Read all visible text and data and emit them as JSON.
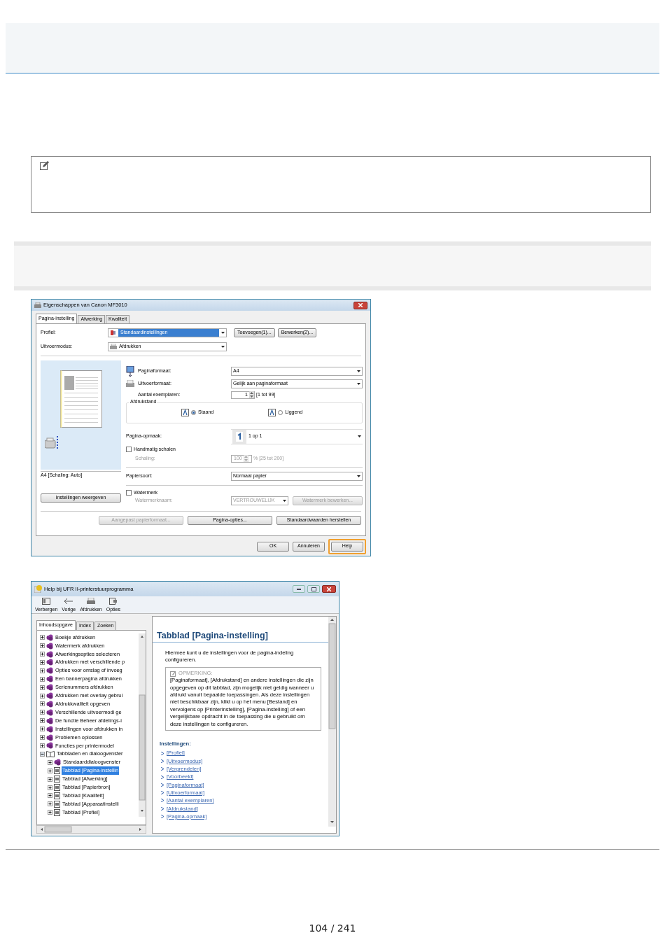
{
  "dialog1": {
    "title": "Eigenschappen van Canon MF3010",
    "tabs": [
      {
        "label": "Pagina-instelling",
        "selected": true
      },
      {
        "label": "Afwerking",
        "selected": false
      },
      {
        "label": "Kwaliteit",
        "selected": false
      }
    ],
    "profile": {
      "label": "Profiel:",
      "value": "Standaardinstellingen"
    },
    "profile_buttons": [
      "Toevoegen(1)...",
      "Bewerken(2)..."
    ],
    "output_mode": {
      "label": "Uitvoermodus:",
      "value": "Afdrukken"
    },
    "preview_caption": "A4 [Schaling: Auto]",
    "show_settings_button": "Instellingen weergeven",
    "page_size": {
      "label": "Paginaformaat:",
      "value": "A4"
    },
    "output_size": {
      "label": "Uitvoerformaat:",
      "value": "Gelijk aan paginaformaat"
    },
    "copies": {
      "label": "Aantal exemplaren:",
      "value": "1",
      "range": "[1 tot 99]"
    },
    "orientation": {
      "legend": "Afdrukstand",
      "options": [
        {
          "label": "Staand",
          "selected": true
        },
        {
          "label": "Liggend",
          "selected": false
        }
      ]
    },
    "layout": {
      "label": "Pagina-opmaak:",
      "value": "1 op 1"
    },
    "manual_scaling": {
      "label": "Handmatig schalen",
      "checked": false
    },
    "scaling": {
      "label": "Schaling:",
      "value": "100",
      "range": "% [25 tot 200]",
      "disabled": true
    },
    "paper_type": {
      "label": "Papiersoort:",
      "value": "Normaal papier"
    },
    "watermark": {
      "label": "Watermerk",
      "checked": false
    },
    "watermark_name": {
      "label": "Watermerknaam:",
      "value": "VERTROUWELIJK",
      "button": "Watermerk bewerken...",
      "disabled": true
    },
    "bottom_buttons": [
      {
        "label": "Aangepast papierformaat...",
        "disabled": true
      },
      {
        "label": "Pagina-opties...",
        "disabled": false
      },
      {
        "label": "Standaardwaarden herstellen",
        "disabled": false
      }
    ],
    "footer_buttons": [
      {
        "label": "OK",
        "highlighted": false
      },
      {
        "label": "Annuleren",
        "highlighted": false
      },
      {
        "label": "Help",
        "highlighted": true
      }
    ]
  },
  "dialog2": {
    "title": "Help bij UFR II-printerstuurprogramma",
    "toolbar": [
      "Verbergen",
      "Vorige",
      "Afdrukken",
      "Opties"
    ],
    "tabs": [
      {
        "label": "Inhoudsopgave",
        "selected": true
      },
      {
        "label": "Index",
        "selected": false
      },
      {
        "label": "Zoeken",
        "selected": false
      }
    ],
    "tree": [
      {
        "label": "Boekje afdrukken",
        "kind": "book",
        "expanded": false,
        "selected": false
      },
      {
        "label": "Watermerk afdrukken",
        "kind": "book",
        "expanded": false,
        "selected": false
      },
      {
        "label": "Afwerkingsopties selecteren",
        "kind": "book",
        "expanded": false,
        "selected": false
      },
      {
        "label": "Afdrukken met verschillende p",
        "kind": "book",
        "expanded": false,
        "selected": false
      },
      {
        "label": "Opties voor omslag of invoeg",
        "kind": "book",
        "expanded": false,
        "selected": false
      },
      {
        "label": "Een bannerpagina afdrukken",
        "kind": "book",
        "expanded": false,
        "selected": false
      },
      {
        "label": "Serienummers afdrukken",
        "kind": "book",
        "expanded": false,
        "selected": false
      },
      {
        "label": "Afdrukken met overlay gebrui",
        "kind": "book",
        "expanded": false,
        "selected": false
      },
      {
        "label": "Afdrukkwaliteit opgeven",
        "kind": "book",
        "expanded": false,
        "selected": false
      },
      {
        "label": "Verschillende uitvoermodi ge",
        "kind": "book",
        "expanded": false,
        "selected": false
      },
      {
        "label": "De functie Beheer afdelings-i",
        "kind": "book",
        "expanded": false,
        "selected": false
      },
      {
        "label": "Instellingen voor afdrukken in",
        "kind": "book",
        "expanded": false,
        "selected": false
      },
      {
        "label": "Problemen oplossen",
        "kind": "book",
        "expanded": false,
        "selected": false
      },
      {
        "label": "Functies per printermodel",
        "kind": "book",
        "expanded": false,
        "selected": false
      },
      {
        "label": "Tabbladen en dialoogvenster",
        "kind": "open_book",
        "expanded": true,
        "selected": false,
        "children": [
          {
            "label": "Standaarddialoogvenster",
            "kind": "book",
            "expanded": false,
            "selected": false
          },
          {
            "label": "Tabblad [Pagina-instellin",
            "kind": "page",
            "expanded": false,
            "selected": true
          },
          {
            "label": "Tabblad [Afwerking]",
            "kind": "page",
            "expanded": false,
            "selected": false
          },
          {
            "label": "Tabblad [Papierbron]",
            "kind": "page",
            "expanded": false,
            "selected": false
          },
          {
            "label": "Tabblad [Kwaliteit]",
            "kind": "page",
            "expanded": false,
            "selected": false
          },
          {
            "label": "Tabblad [Apparaatinstelli",
            "kind": "page",
            "expanded": false,
            "selected": false
          },
          {
            "label": "Tabblad [Profiel]",
            "kind": "page",
            "expanded": false,
            "selected": false
          }
        ]
      }
    ],
    "heading": "Tabblad [Pagina-instelling]",
    "intro": "Hiermee kunt u de instellingen voor de pagina-indeling configureren.",
    "note": {
      "title": "OPMERKING:",
      "text": "[Paginaformaat], [Afdrukstand] en andere instellingen die zijn opgegeven op dit tabblad, zijn mogelijk niet geldig wanneer u afdrukt vanuit bepaalde toepassingen. Als deze instellingen niet beschikbaar zijn, klikt u op het menu [Bestand] en vervolgens op [Printerinstelling], [Pagina-instelling] of een vergelijkbare opdracht in de toepassing die u gebruikt om deze instellingen te configureren."
    },
    "settings_heading": "Instellingen:",
    "links": [
      "[Profiel]",
      "[Uitvoermodus]",
      "[Vergrendelen]",
      "[Voorbeeld]",
      "[Paginaformaat]",
      "[Uitvoerformaat]",
      "[Aantal exemplaren]",
      "[Afdrukstand]",
      "[Pagina-opmaak]"
    ]
  },
  "page_number": "104 / 241"
}
